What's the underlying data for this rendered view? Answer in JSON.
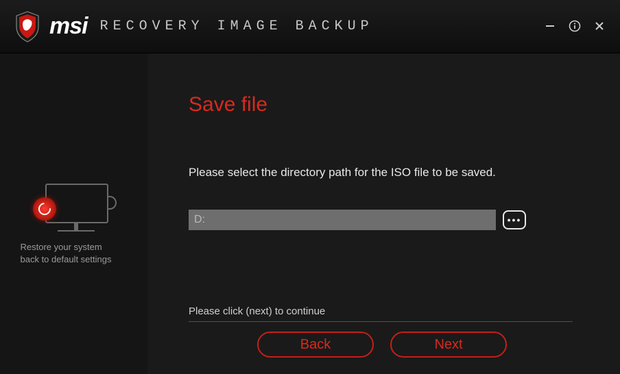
{
  "header": {
    "brand": "msi",
    "app_title": "RECOVERY IMAGE BACKUP"
  },
  "sidebar": {
    "caption_line1": "Restore your system",
    "caption_line2": "back to default settings"
  },
  "main": {
    "heading": "Save file",
    "instruction": "Please select the directory path for the ISO file to be saved.",
    "path_value": "D:",
    "browse_label": "•••",
    "continue_hint": "Please click (next) to continue",
    "back_label": "Back",
    "next_label": "Next"
  }
}
